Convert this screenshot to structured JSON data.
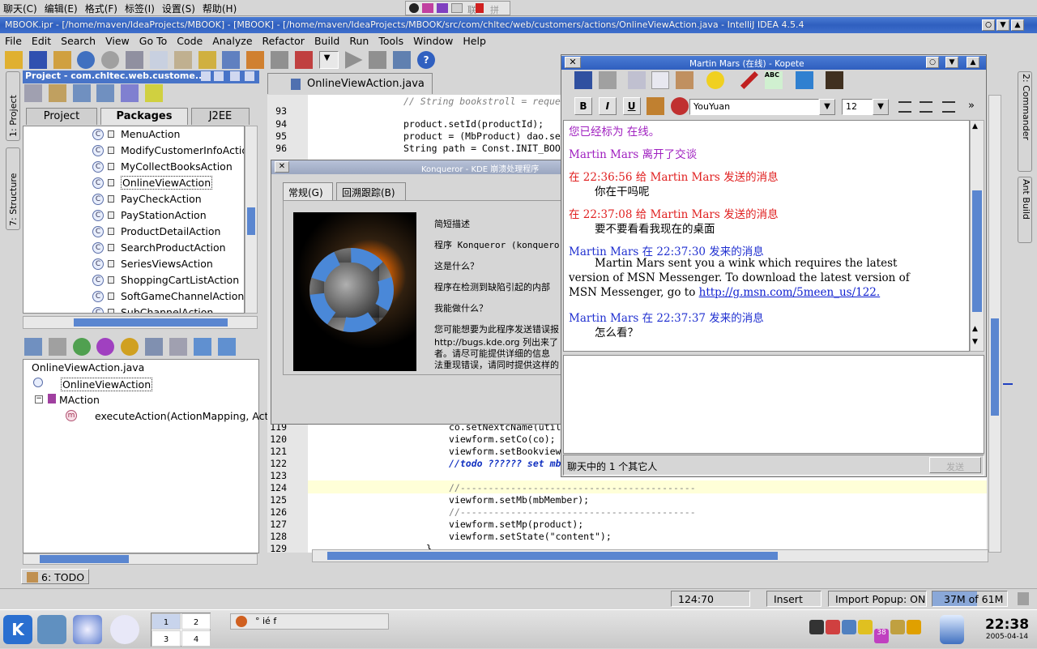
{
  "topmenu": [
    "聊天(C)",
    "编辑(E)",
    "格式(F)",
    "标签(I)",
    "设置(S)",
    "帮助(H)"
  ],
  "topmenu_right": "拼音",
  "idea": {
    "title": "MBOOK.ipr - [/home/maven/IdeaProjects/MBOOK] - [MBOOK] - [/home/maven/IdeaProjects/MBOOK/src/com/chltec/web/customers/actions/OnlineViewAction.java - IntelliJ IDEA 4.5.4",
    "menu": [
      "File",
      "Edit",
      "Search",
      "View",
      "Go To",
      "Code",
      "Analyze",
      "Refactor",
      "Build",
      "Run",
      "Tools",
      "Window",
      "Help"
    ]
  },
  "project": {
    "header": "Project - com.chltec.web.custome...",
    "tabs": [
      "Project",
      "Packages",
      "J2EE"
    ],
    "items": [
      "MenuAction",
      "ModifyCustomerInfoAction",
      "MyCollectBooksAction",
      "OnlineViewAction",
      "PayCheckAction",
      "PayStationAction",
      "ProductDetailAction",
      "SearchProductAction",
      "SeriesViewsAction",
      "ShoppingCartListAction",
      "SoftGameChannelAction",
      "SubChannelAction"
    ]
  },
  "left_tabs": {
    "project": "1: Project",
    "structure": "7: Structure"
  },
  "structure": {
    "file": "OnlineViewAction.java",
    "class": "OnlineViewAction",
    "parent": "MAction",
    "method": "executeAction(ActionMapping, Actio"
  },
  "todo": "6: TODO",
  "editor": {
    "tab": "OnlineViewAction.java",
    "top_lines": [
      {
        "n": "93",
        "t": "// String bookstroll = reque"
      },
      {
        "n": "94",
        "t": "product.setId(productId);"
      },
      {
        "n": "95",
        "t": "product = (MbProduct) dao.se"
      },
      {
        "n": "96",
        "t": "String path = Const.INIT_BOO"
      }
    ],
    "bottom_lines": [
      {
        "n": "119",
        "t": "co.setNextcName(util"
      },
      {
        "n": "120",
        "t": "viewform.setCo(co);"
      },
      {
        "n": "121",
        "t": "viewform.setBookview"
      },
      {
        "n": "122",
        "t": "//todo ?????? set mb"
      },
      {
        "n": "123",
        "t": ""
      },
      {
        "n": "124",
        "t": "//------------------------------------------"
      },
      {
        "n": "125",
        "t": "viewform.setMb(mbMember);"
      },
      {
        "n": "126",
        "t": "//------------------------------------------"
      },
      {
        "n": "127",
        "t": "viewform.setMp(product);"
      },
      {
        "n": "128",
        "t": "viewform.setState(\"content\");"
      },
      {
        "n": "129",
        "t": "}"
      }
    ]
  },
  "right_tabs": {
    "commander": "2: Commander",
    "ant": "Ant Build"
  },
  "status": {
    "position": "124:70",
    "mode": "Insert",
    "popup": "Import Popup: ON",
    "memory": "37M of 61M",
    "memory_fraction": 0.6
  },
  "konqueror": {
    "title": "Konqueror - KDE 崩溃处理程序",
    "tabs": [
      "常规(G)",
      "回溯跟踪(B)"
    ],
    "lines": [
      "简短描述",
      "程序 Konqueror (konqueror)",
      "这是什么？",
      "程序在检测到缺陷引起的内部",
      "我能做什么？",
      "您可能想要为此程序发送错误报",
      "http://bugs.kde.org 列出来了",
      "者。请尽可能提供详细的信息",
      "法重现错误，请同时提供这样的"
    ]
  },
  "kopete": {
    "title": "Martin Mars (在线) - Kopete",
    "font_name": "YouYuan",
    "font_size": "12",
    "messages": [
      {
        "text": "您已经标为 在线。",
        "color": "#a020c0"
      },
      {
        "text": "Martin Mars 离开了交谈",
        "color": "#a020c0"
      },
      {
        "text": "在 22:36:56 给 Martin Mars 发送的消息",
        "color": "#e02020"
      },
      {
        "text": "你在干吗呢",
        "color": "#000000"
      },
      {
        "text": "在 22:37:08 给 Martin Mars 发送的消息",
        "color": "#e02020"
      },
      {
        "text": "要不要看看我现在的桌面",
        "color": "#000000"
      },
      {
        "text": "Martin Mars 在 22:37:30 发来的消息",
        "color": "#2030d0"
      },
      {
        "text": "Martin Mars sent you a wink which requires the latest",
        "color": "#000000"
      },
      {
        "text": "version of MSN Messenger. To download the latest version of",
        "color": "#000000"
      },
      {
        "text": "MSN Messenger, go to ",
        "color": "#000000"
      },
      {
        "text": "Martin Mars 在 22:37:37 发来的消息",
        "color": "#2030d0"
      },
      {
        "text": "怎么看？",
        "color": "#000000"
      }
    ],
    "link": "http://g.msn.com/5meen_us/122.",
    "status_text": "聊天中的 1 个其它人",
    "send": "发送"
  },
  "taskbar": {
    "pager": [
      "1",
      "2",
      "3",
      "4"
    ],
    "task": "° ié  f",
    "tray_badge": "38",
    "time": "22:38",
    "date": "2005-04-14"
  }
}
